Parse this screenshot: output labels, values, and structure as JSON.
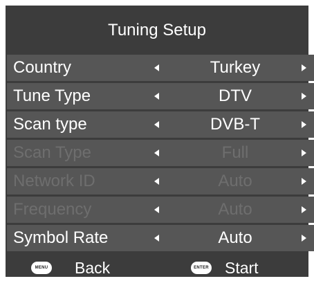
{
  "title": "Tuning Setup",
  "rows": [
    {
      "label": "Country",
      "value": "Turkey",
      "enabled": true
    },
    {
      "label": "Tune Type",
      "value": "DTV",
      "enabled": true
    },
    {
      "label": "Scan type",
      "value": "DVB-T",
      "enabled": true
    },
    {
      "label": "Scan Type",
      "value": "Full",
      "enabled": false
    },
    {
      "label": "Network ID",
      "value": "Auto",
      "enabled": false
    },
    {
      "label": "Frequency",
      "value": "Auto",
      "enabled": false
    },
    {
      "label": "Symbol Rate",
      "value": "Auto",
      "enabled": true
    }
  ],
  "footer": {
    "menu_key": "MENU",
    "menu_action": "Back",
    "enter_key": "ENTER",
    "enter_action": "Start"
  },
  "colors": {
    "panel": "#3c3c3c",
    "row": "#565656",
    "text": "#ffffff",
    "disabled_text": "#6e6e6e"
  },
  "icons": {
    "left": "arrow-left-icon",
    "right": "arrow-right-icon"
  }
}
